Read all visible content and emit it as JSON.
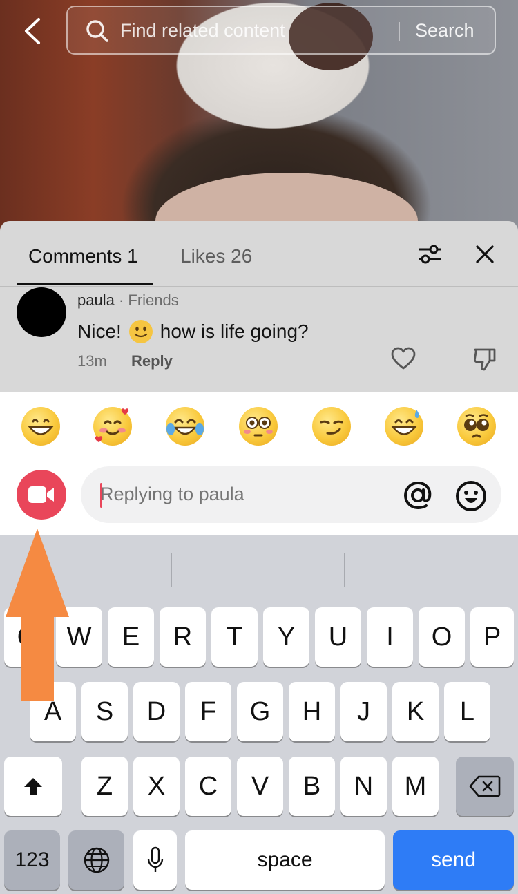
{
  "search": {
    "placeholder": "Find related content",
    "button": "Search"
  },
  "tabs": {
    "comments": "Comments 1",
    "likes": "Likes 26"
  },
  "comment": {
    "username": "paula",
    "relation": "· Friends",
    "text_before": "Nice!",
    "text_after": "how is life going?",
    "time": "13m",
    "reply": "Reply"
  },
  "emoji_bar": [
    "grinning-face",
    "smiling-face-with-hearts",
    "face-with-tears-of-joy",
    "flushed-face",
    "smirking-face",
    "grinning-face-with-sweat",
    "pleading-face"
  ],
  "composer": {
    "placeholder": "Replying to paula"
  },
  "keyboard": {
    "row1": [
      "Q",
      "W",
      "E",
      "R",
      "T",
      "Y",
      "U",
      "I",
      "O",
      "P"
    ],
    "row2": [
      "A",
      "S",
      "D",
      "F",
      "G",
      "H",
      "J",
      "K",
      "L"
    ],
    "row3": [
      "Z",
      "X",
      "C",
      "V",
      "B",
      "N",
      "M"
    ],
    "numbers": "123",
    "space": "space",
    "send": "send"
  },
  "colors": {
    "accent": "#e9465a",
    "send": "#2e7cf6",
    "annotation_arrow": "#f58a42"
  }
}
